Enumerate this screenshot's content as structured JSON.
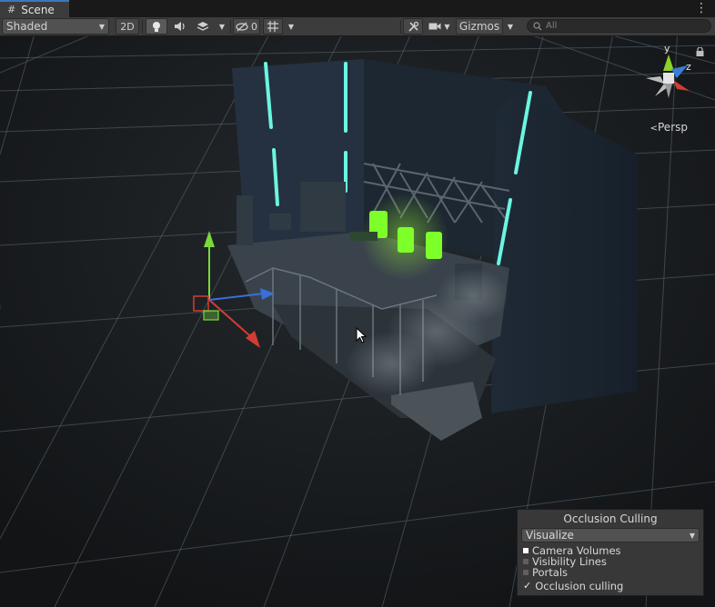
{
  "tab": {
    "icon": "grid-hash-icon",
    "label": "Scene",
    "menu_icon": "kebab-menu-icon"
  },
  "toolbar": {
    "shading_mode": "Shaded",
    "mode_2d_label": "2D",
    "lighting_icon": "lightbulb-icon",
    "audio_icon": "speaker-icon",
    "effects_icon": "layers-icon",
    "hidden_count_icon": "eye-slash-icon",
    "hidden_count": "0",
    "grid_icon": "grid-icon",
    "tools_icon": "wrench-icon",
    "camera_icon": "camera-icon",
    "gizmos_label": "Gizmos",
    "search_placeholder": "All"
  },
  "orientation_gizmo": {
    "y_label": "y",
    "z_label": "z",
    "projection_label": "Persp",
    "lock_icon": "lock-icon",
    "colors": {
      "y": "#8ed127",
      "z": "#3a7dd8",
      "x": "#d33c32"
    }
  },
  "occlusion_panel": {
    "title": "Occlusion Culling",
    "mode": "Visualize",
    "items": [
      {
        "label": "Camera Volumes",
        "swatch": "#ffffff"
      },
      {
        "label": "Visibility Lines",
        "swatch": "#5f5f5f"
      },
      {
        "label": "Portals",
        "swatch": "#5f5f5f"
      }
    ],
    "toggle": {
      "label": "Occlusion culling",
      "checked": true
    }
  },
  "colors": {
    "accent": "#3a79bb",
    "neon_light": "#6cf5e0",
    "green_glow": "#7dff2a",
    "move_handle_x": "#d33c32",
    "move_handle_y": "#79d93a",
    "move_handle_z": "#3a6fd8"
  }
}
